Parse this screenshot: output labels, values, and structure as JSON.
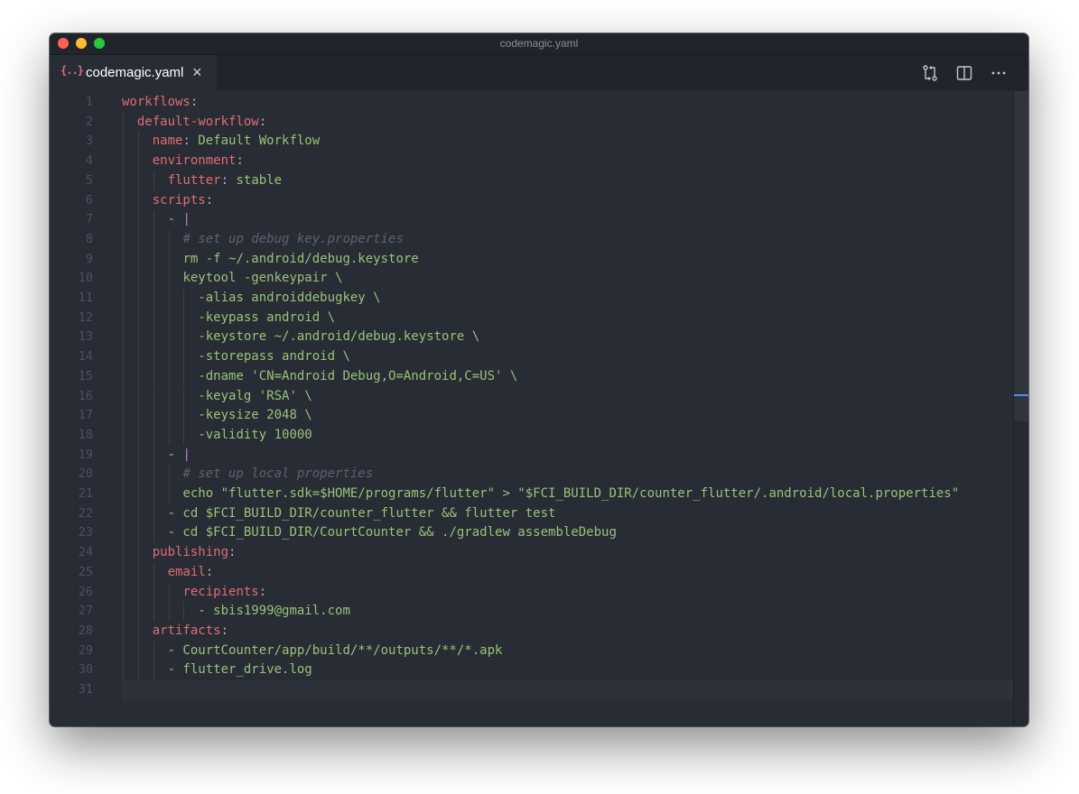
{
  "window": {
    "title": "codemagic.yaml",
    "controls": {
      "close_color": "#ff5f57",
      "minimize_color": "#febc2e",
      "zoom_color": "#28c840"
    }
  },
  "tab": {
    "icon": "{..}",
    "icon_name": "json-braces-icon",
    "label": "codemagic.yaml",
    "close_icon": "×"
  },
  "actions": {
    "icons": [
      "git-compare-icon",
      "split-editor-icon",
      "more-actions-icon"
    ],
    "more_glyph": "···"
  },
  "colors": {
    "background": "#282c34",
    "key": "#e06c75",
    "string": "#98c379",
    "punctuation": "#abb2bf",
    "comment": "#5c6370",
    "block_indicator": "#c678dd"
  },
  "editor": {
    "current_line": 31,
    "lines": [
      {
        "num": "1",
        "indent": "",
        "key": "workflows",
        "colon": ":",
        "value": "",
        "comment": "",
        "block": ""
      },
      {
        "num": "2",
        "indent": "  ",
        "key": "default-workflow",
        "colon": ":",
        "value": "",
        "comment": "",
        "block": ""
      },
      {
        "num": "3",
        "indent": "    ",
        "key": "name",
        "colon": ":",
        "value": " Default Workflow",
        "comment": "",
        "block": ""
      },
      {
        "num": "4",
        "indent": "    ",
        "key": "environment",
        "colon": ":",
        "value": "",
        "comment": "",
        "block": ""
      },
      {
        "num": "5",
        "indent": "      ",
        "key": "flutter",
        "colon": ":",
        "value": " stable",
        "comment": "",
        "block": ""
      },
      {
        "num": "6",
        "indent": "    ",
        "key": "scripts",
        "colon": ":",
        "value": "",
        "comment": "",
        "block": ""
      },
      {
        "num": "7",
        "indent": "      ",
        "key": "",
        "colon": "",
        "value": "- ",
        "comment": "",
        "block": "|"
      },
      {
        "num": "8",
        "indent": "        ",
        "key": "",
        "colon": "",
        "value": "",
        "comment": "# set up debug key.properties",
        "block": ""
      },
      {
        "num": "9",
        "indent": "        ",
        "key": "",
        "colon": "",
        "value": "rm -f ~/.android/debug.keystore",
        "comment": "",
        "block": ""
      },
      {
        "num": "10",
        "indent": "        ",
        "key": "",
        "colon": "",
        "value": "keytool -genkeypair \\",
        "comment": "",
        "block": ""
      },
      {
        "num": "11",
        "indent": "          ",
        "key": "",
        "colon": "",
        "value": "-alias androiddebugkey \\",
        "comment": "",
        "block": ""
      },
      {
        "num": "12",
        "indent": "          ",
        "key": "",
        "colon": "",
        "value": "-keypass android \\",
        "comment": "",
        "block": ""
      },
      {
        "num": "13",
        "indent": "          ",
        "key": "",
        "colon": "",
        "value": "-keystore ~/.android/debug.keystore \\",
        "comment": "",
        "block": ""
      },
      {
        "num": "14",
        "indent": "          ",
        "key": "",
        "colon": "",
        "value": "-storepass android \\",
        "comment": "",
        "block": ""
      },
      {
        "num": "15",
        "indent": "          ",
        "key": "",
        "colon": "",
        "value": "-dname 'CN=Android Debug,O=Android,C=US' \\",
        "comment": "",
        "block": ""
      },
      {
        "num": "16",
        "indent": "          ",
        "key": "",
        "colon": "",
        "value": "-keyalg 'RSA' \\",
        "comment": "",
        "block": ""
      },
      {
        "num": "17",
        "indent": "          ",
        "key": "",
        "colon": "",
        "value": "-keysize 2048 \\",
        "comment": "",
        "block": ""
      },
      {
        "num": "18",
        "indent": "          ",
        "key": "",
        "colon": "",
        "value": "-validity 10000",
        "comment": "",
        "block": ""
      },
      {
        "num": "19",
        "indent": "      ",
        "key": "",
        "colon": "",
        "value": "- ",
        "comment": "",
        "block": "|"
      },
      {
        "num": "20",
        "indent": "        ",
        "key": "",
        "colon": "",
        "value": "",
        "comment": "# set up local properties",
        "block": ""
      },
      {
        "num": "21",
        "indent": "        ",
        "key": "",
        "colon": "",
        "value": "echo \"flutter.sdk=$HOME/programs/flutter\" > \"$FCI_BUILD_DIR/counter_flutter/.android/local.properties\"",
        "comment": "",
        "block": ""
      },
      {
        "num": "22",
        "indent": "      ",
        "key": "",
        "colon": "",
        "value": "- cd $FCI_BUILD_DIR/counter_flutter && flutter test",
        "comment": "",
        "block": ""
      },
      {
        "num": "23",
        "indent": "      ",
        "key": "",
        "colon": "",
        "value": "- cd $FCI_BUILD_DIR/CourtCounter && ./gradlew assembleDebug",
        "comment": "",
        "block": ""
      },
      {
        "num": "24",
        "indent": "    ",
        "key": "publishing",
        "colon": ":",
        "value": "",
        "comment": "",
        "block": ""
      },
      {
        "num": "25",
        "indent": "      ",
        "key": "email",
        "colon": ":",
        "value": "",
        "comment": "",
        "block": ""
      },
      {
        "num": "26",
        "indent": "        ",
        "key": "recipients",
        "colon": ":",
        "value": "",
        "comment": "",
        "block": ""
      },
      {
        "num": "27",
        "indent": "          ",
        "key": "",
        "colon": "",
        "value": "- sbis1999@gmail.com",
        "comment": "",
        "block": ""
      },
      {
        "num": "28",
        "indent": "    ",
        "key": "artifacts",
        "colon": ":",
        "value": "",
        "comment": "",
        "block": ""
      },
      {
        "num": "29",
        "indent": "      ",
        "key": "",
        "colon": "",
        "value": "- CourtCounter/app/build/**/outputs/**/*.apk",
        "comment": "",
        "block": ""
      },
      {
        "num": "30",
        "indent": "      ",
        "key": "",
        "colon": "",
        "value": "- flutter_drive.log",
        "comment": "",
        "block": ""
      },
      {
        "num": "31",
        "indent": "",
        "key": "",
        "colon": "",
        "value": "",
        "comment": "",
        "block": ""
      }
    ]
  }
}
